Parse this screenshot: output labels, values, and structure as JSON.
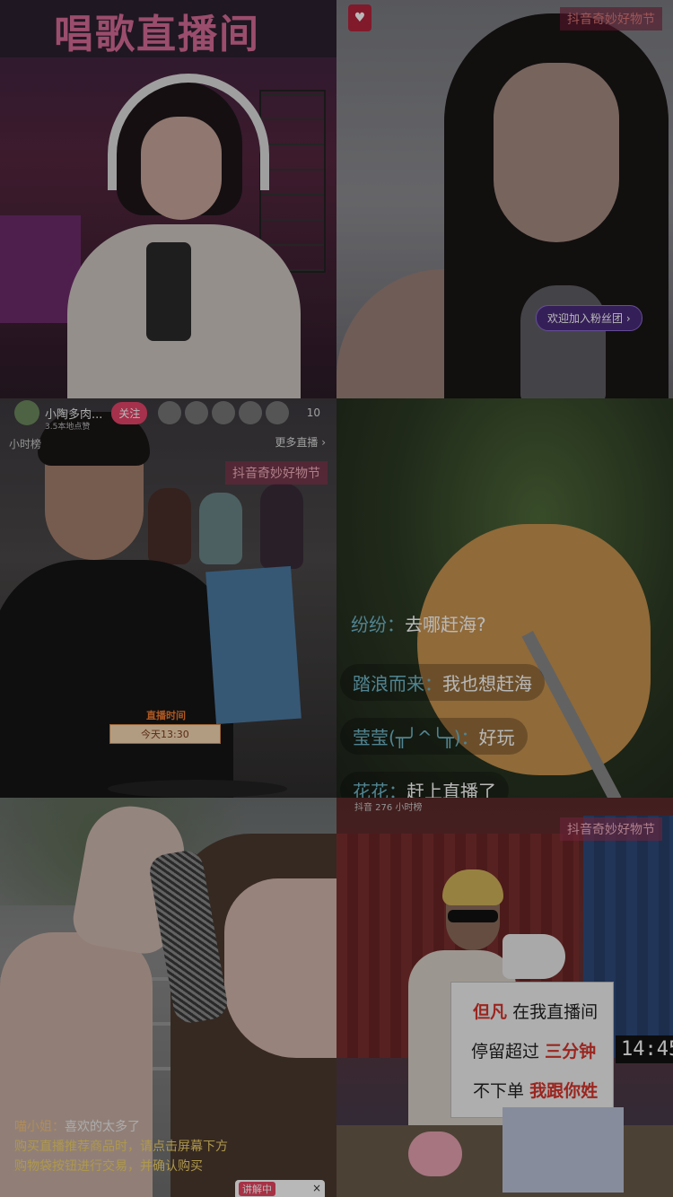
{
  "tiles": {
    "t1": {
      "banner": "唱歌直播间"
    },
    "t2": {
      "badge": "♥",
      "brand": "抖音奇妙好物节",
      "fan_cta": "欢迎加入粉丝团 ›"
    },
    "t3": {
      "streamer_name": "小陶多肉...",
      "streamer_sub": "3.5本地点赞",
      "follow": "关注",
      "viewer_count": "10",
      "hourly_rank": "小时榜",
      "more_live": "更多直播 ›",
      "brand": "抖音奇妙好物节",
      "schedule_tag": "直播时间",
      "schedule_time": "今天13:30"
    },
    "t4": {
      "comments": [
        {
          "user": "纷纷：",
          "text": "去哪赶海?"
        },
        {
          "user": "踏浪而来：",
          "text": "我也想赶海"
        },
        {
          "user": "莹莹(╥╯^╰╥)：",
          "text": "好玩"
        },
        {
          "user": "花花：",
          "text": "赶上直播了"
        }
      ]
    },
    "t5": {
      "comment_user": "喵小姐：",
      "comment_text": "喜欢的太多了",
      "notice": "购买直播推荐商品时，请点击屏幕下方购物袋按钮进行交易，并确认购买",
      "explaining": "讲解中",
      "close": "×"
    },
    "t6": {
      "top_info": "抖音  276   小时榜",
      "brand": "抖音奇妙好物节",
      "sign_line1_red": "但凡",
      "sign_line1": "在我直播间",
      "sign_line2": "停留超过",
      "sign_line2_red": "三分钟",
      "sign_line3": "不下单",
      "sign_line3_red": "我跟你姓",
      "clock": "14:45"
    }
  }
}
